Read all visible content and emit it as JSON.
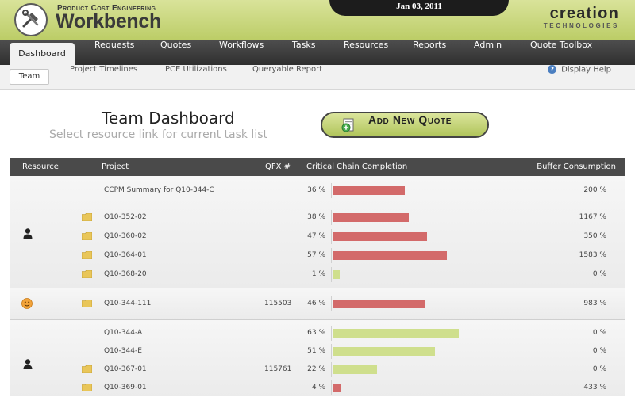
{
  "header": {
    "brand_sub": "Product Cost Engineering",
    "brand_main": "Workbench",
    "date": "Jan 03, 2011",
    "company_main": "creation",
    "company_sub": "TECHNOLOGIES",
    "logo_icon": "wrench-hammer-icon"
  },
  "nav": {
    "items": [
      {
        "label": "Dashboard",
        "active": true
      },
      {
        "label": "Requests"
      },
      {
        "label": "Quotes"
      },
      {
        "label": "Workflows"
      },
      {
        "label": "Tasks"
      },
      {
        "label": "Resources"
      },
      {
        "label": "Reports"
      },
      {
        "label": "Admin"
      },
      {
        "label": "Quote Toolbox"
      }
    ]
  },
  "subnav": {
    "items": [
      {
        "label": "Team",
        "active": true
      },
      {
        "label": "Project Timelines"
      },
      {
        "label": "PCE Utilizations"
      },
      {
        "label": "Queryable Report"
      }
    ],
    "help": "Display Help",
    "help_icon": "help-icon"
  },
  "dashboard": {
    "title": "Team Dashboard",
    "subtitle": "Select resource link for current task list",
    "add_button": "Add New Quote",
    "add_icon": "add-document-icon"
  },
  "table": {
    "headers": {
      "resource": "Resource",
      "project": "Project",
      "qfx": "QFX #",
      "ccc": "Critical Chain Completion",
      "buffer": "Buffer Consumption"
    },
    "colors": {
      "red": "#d36a6a",
      "green": "#cfdf8d"
    },
    "groups": [
      {
        "resource_icon": "person-icon",
        "rows": [
          {
            "project": "CCPM Summary for Q10-344-C",
            "folder": false,
            "qfx": "",
            "completion": "36 %",
            "value": 36,
            "color": "red",
            "buffer": "200 %"
          },
          {
            "project": "Q10-352-02",
            "folder": true,
            "qfx": "",
            "completion": "38 %",
            "value": 38,
            "color": "red",
            "buffer": "1167 %"
          },
          {
            "project": "Q10-360-02",
            "folder": true,
            "qfx": "",
            "completion": "47 %",
            "value": 47,
            "color": "red",
            "buffer": "350 %"
          },
          {
            "project": "Q10-364-01",
            "folder": true,
            "qfx": "",
            "completion": "57 %",
            "value": 57,
            "color": "red",
            "buffer": "1583 %"
          },
          {
            "project": "Q10-368-20",
            "folder": true,
            "qfx": "",
            "completion": "1 %",
            "value": 1,
            "color": "green",
            "buffer": "0 %"
          }
        ]
      },
      {
        "resource_icon": "smiley-icon",
        "rows": [
          {
            "project": "Q10-344-111",
            "folder": true,
            "qfx": "115503",
            "completion": "46 %",
            "value": 46,
            "color": "red",
            "buffer": "983 %"
          }
        ]
      },
      {
        "resource_icon": "person-icon",
        "rows": [
          {
            "project": "Q10-344-A",
            "folder": false,
            "qfx": "",
            "completion": "63 %",
            "value": 63,
            "color": "green",
            "buffer": "0 %"
          },
          {
            "project": "Q10-344-E",
            "folder": false,
            "qfx": "",
            "completion": "51 %",
            "value": 51,
            "color": "green",
            "buffer": "0 %"
          },
          {
            "project": "Q10-367-01",
            "folder": true,
            "qfx": "115761",
            "completion": "22 %",
            "value": 22,
            "color": "green",
            "buffer": "0 %"
          },
          {
            "project": "Q10-369-01",
            "folder": true,
            "qfx": "",
            "completion": "4 %",
            "value": 4,
            "color": "red",
            "buffer": "433 %"
          }
        ]
      }
    ]
  }
}
